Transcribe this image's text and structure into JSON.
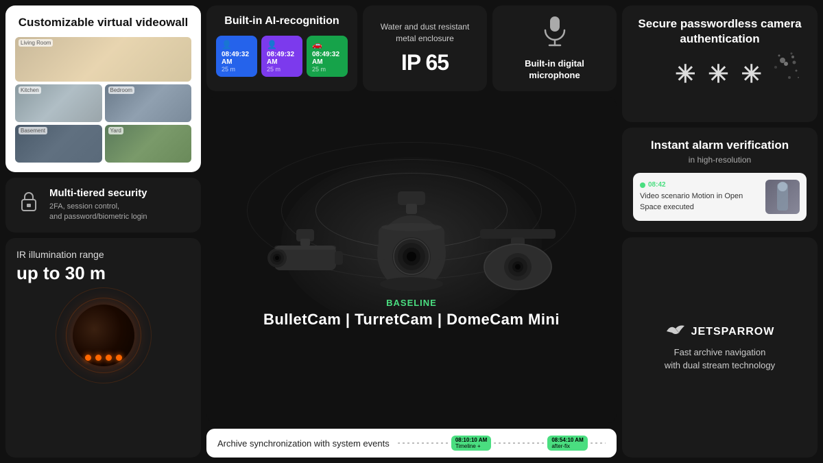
{
  "videowall": {
    "title": "Customizable virtual videowall",
    "rooms": [
      {
        "label": "Living Room",
        "type": "living"
      },
      {
        "label": "Kitchen",
        "type": "kitchen"
      },
      {
        "label": "Bedroom",
        "type": "bedroom"
      },
      {
        "label": "Basement",
        "type": "basement"
      },
      {
        "label": "Yard",
        "type": "yard"
      }
    ]
  },
  "security": {
    "title": "Multi-tiered security",
    "desc": "2FA, session control,\nand password/biometric login"
  },
  "ir": {
    "title": "IR illumination range",
    "range": "up to 30 m"
  },
  "ai": {
    "title": "Built-in AI-recognition",
    "badges": [
      {
        "type": "person",
        "time": "08:49:32 AM",
        "dist": "25 m",
        "color": "blue"
      },
      {
        "type": "person",
        "time": "08:49:32 AM",
        "dist": "25 m",
        "color": "purple"
      },
      {
        "type": "vehicle",
        "time": "08:49:32 AM",
        "dist": "25 m",
        "color": "green"
      }
    ]
  },
  "ip65": {
    "title": "Water and dust resistant metal enclosure",
    "badge": "IP 65"
  },
  "microphone": {
    "title": "Built-in digital microphone"
  },
  "cameras": {
    "brand": "BASELINE",
    "brand_letter": "B",
    "models": "BulletCam  |  TurretCam  |  DomeCam Mini"
  },
  "archive": {
    "label": "Archive synchronization with system events",
    "event1_time": "08:10:10 AM",
    "event1_sub": "Timeline +",
    "event2_time": "08:54:10 AM",
    "event2_sub": "after-fix"
  },
  "passwordless": {
    "title": "Secure passwordless camera authentication",
    "asterisks": "* * *"
  },
  "alarm": {
    "title": "Instant alarm verification",
    "sub": "in high-resolution",
    "notif_time": "08:42",
    "notif_msg": "Video scenario Motion in Open Space executed"
  },
  "jetsparrow": {
    "name": "JETSPARROW",
    "desc": "Fast archive navigation\nwith dual stream technology"
  }
}
